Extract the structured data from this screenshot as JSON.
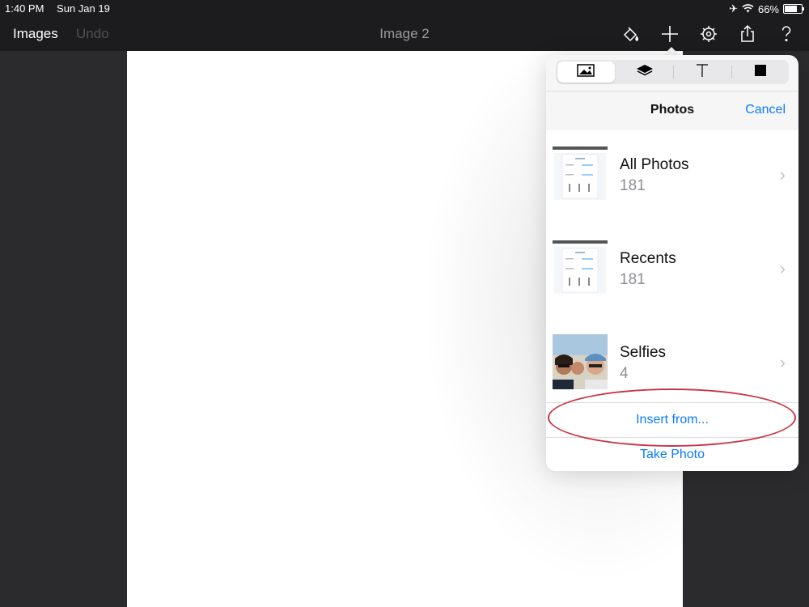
{
  "statusbar": {
    "time": "1:40 PM",
    "date": "Sun Jan 19",
    "battery": "66%",
    "battery_level": 0.66
  },
  "navbar": {
    "images_label": "Images",
    "undo_label": "Undo",
    "title": "Image 2"
  },
  "popover": {
    "tabs": [
      {
        "icon": "image-icon",
        "active": true
      },
      {
        "icon": "layers-icon",
        "active": false
      },
      {
        "icon": "text-icon",
        "active": false
      },
      {
        "icon": "shape-icon",
        "active": false
      }
    ],
    "title": "Photos",
    "cancel_label": "Cancel",
    "albums": [
      {
        "name": "All Photos",
        "count": "181"
      },
      {
        "name": "Recents",
        "count": "181"
      },
      {
        "name": "Selfies",
        "count": "4"
      }
    ],
    "insert_label": "Insert from...",
    "take_photo_label": "Take Photo"
  },
  "colors": {
    "accent": "#0a7cff",
    "annotation": "#c93645",
    "toolbar": "#1c1c1e",
    "workspace": "#2b2b2d"
  }
}
